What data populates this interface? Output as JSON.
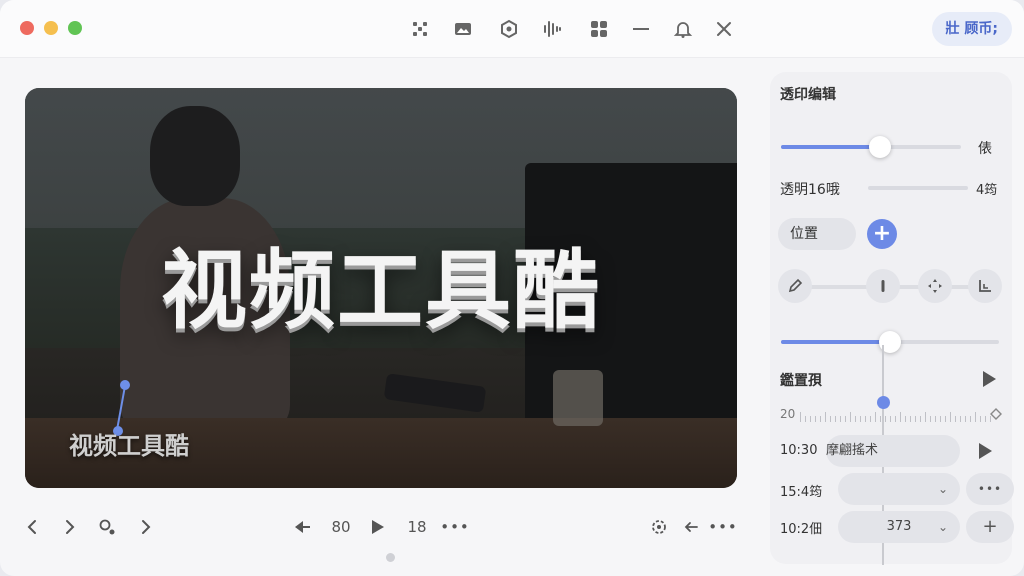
{
  "header": {
    "top_right_button": "壯 顾币;",
    "toolbar_icons": [
      "grid-dots-icon",
      "image-icon",
      "puzzle-icon",
      "waveform-icon",
      "layout-icon",
      "minus-icon",
      "bell-icon",
      "close-icon"
    ]
  },
  "preview": {
    "main_title": "视频工具酷",
    "sub_title": "视频工具酷"
  },
  "bottom_controls": {
    "prev_label": "‹",
    "next_label": "›",
    "counter_left": "80",
    "counter_right": "18",
    "more": "•••"
  },
  "panel": {
    "section_title": "透印编辑",
    "slider1_right_label": "俵",
    "slider1_value": 0.55,
    "opacity_label": "透明16哦",
    "opacity_right_label": "4筠",
    "position_chip": "位置",
    "slider2_value": 0.5,
    "timeline_label": "鑑置孭",
    "ruler_left_label": "20",
    "rows": [
      {
        "time": "10:30",
        "field": "摩翩搖术"
      },
      {
        "time": "15:4筠",
        "field": ""
      },
      {
        "time": "10:2佃",
        "field": "373"
      }
    ]
  },
  "colors": {
    "accent": "#6d8ae6",
    "traffic_red": "#ee6a5f",
    "traffic_yellow": "#f5bf4f",
    "traffic_green": "#61c454"
  }
}
